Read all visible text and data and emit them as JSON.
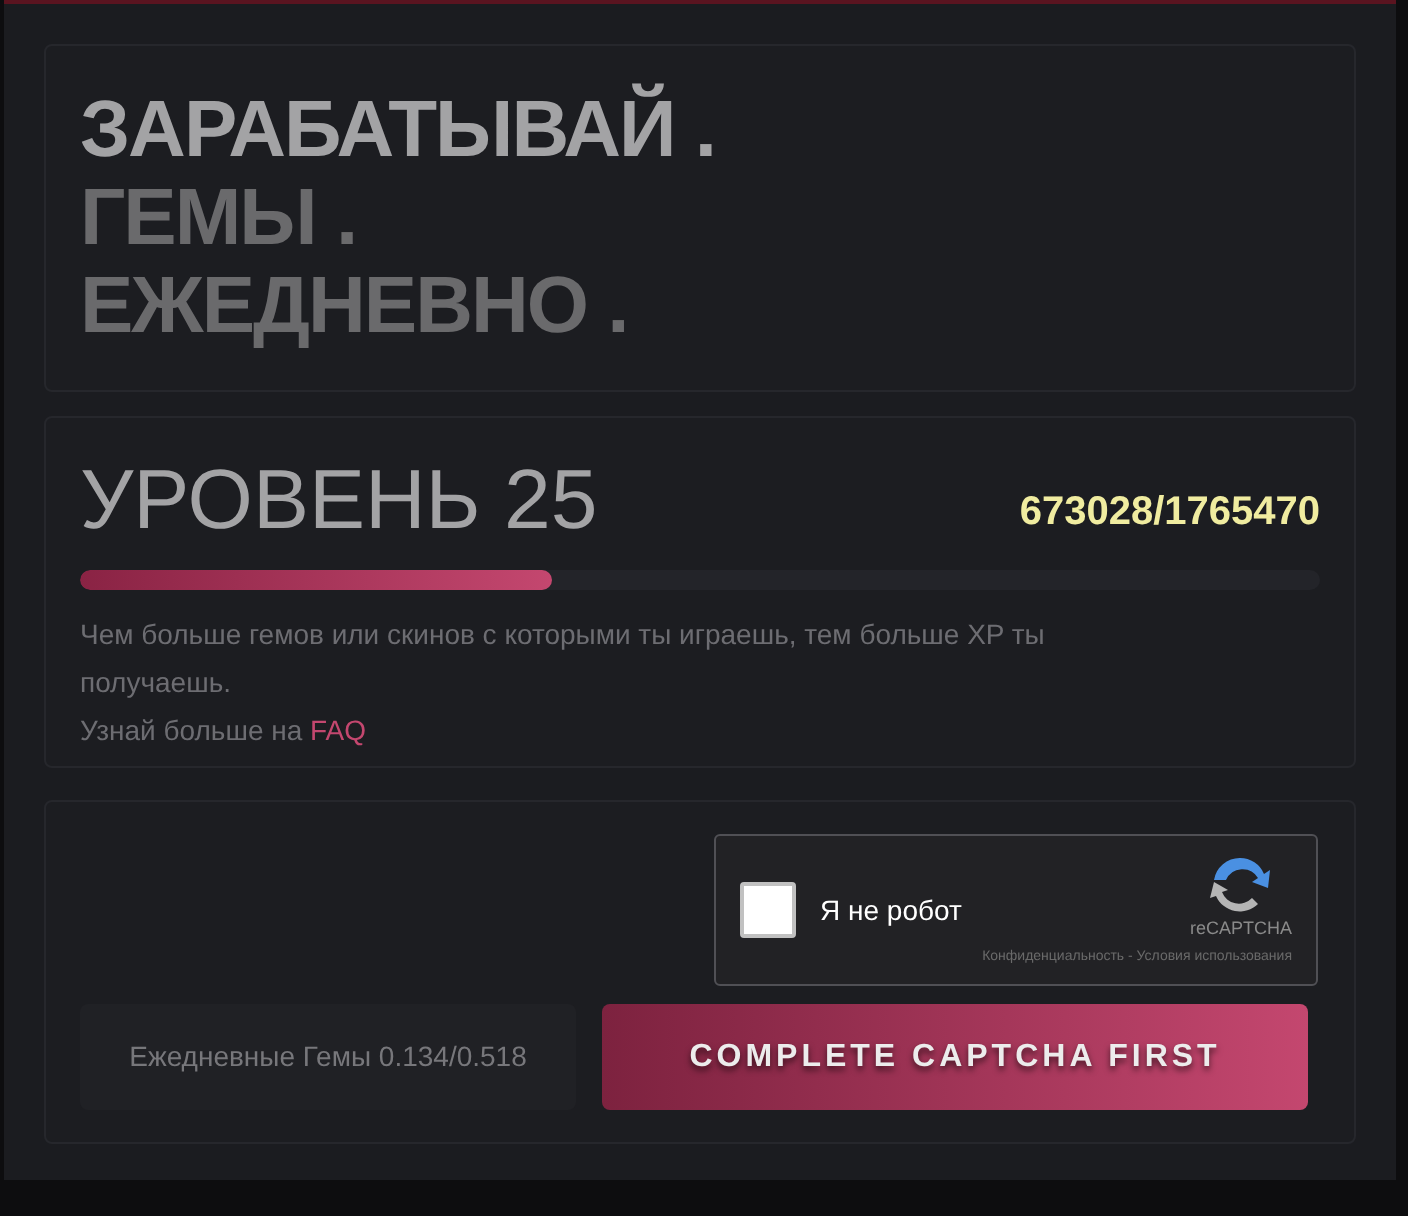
{
  "headline": [
    {
      "text": "ЗАРАБАТЫВАЙ .",
      "highlight": true
    },
    {
      "text": "ГЕМЫ .",
      "highlight": false
    },
    {
      "text": "ЕЖЕДНЕВНО .",
      "highlight": false
    }
  ],
  "level": {
    "title": "УРОВЕНЬ 25",
    "xp": "673028/1765470",
    "level": 0.381,
    "description": "Чем больше гемов или скинов с которыми ты играешь, тем больше XP ты получаешь.",
    "more": "Узнай больше на",
    "link": "FAQ"
  },
  "captcha": {
    "checked": false,
    "label": "Я не робот",
    "brand": "reCAPTCHA",
    "terms": "Конфиденциальность - Условия использования"
  },
  "daily": "Ежедневные Гемы 0.134/0.518",
  "button": {
    "label": "COMPLETE CAPTCHA FIRST",
    "disabled": true
  }
}
